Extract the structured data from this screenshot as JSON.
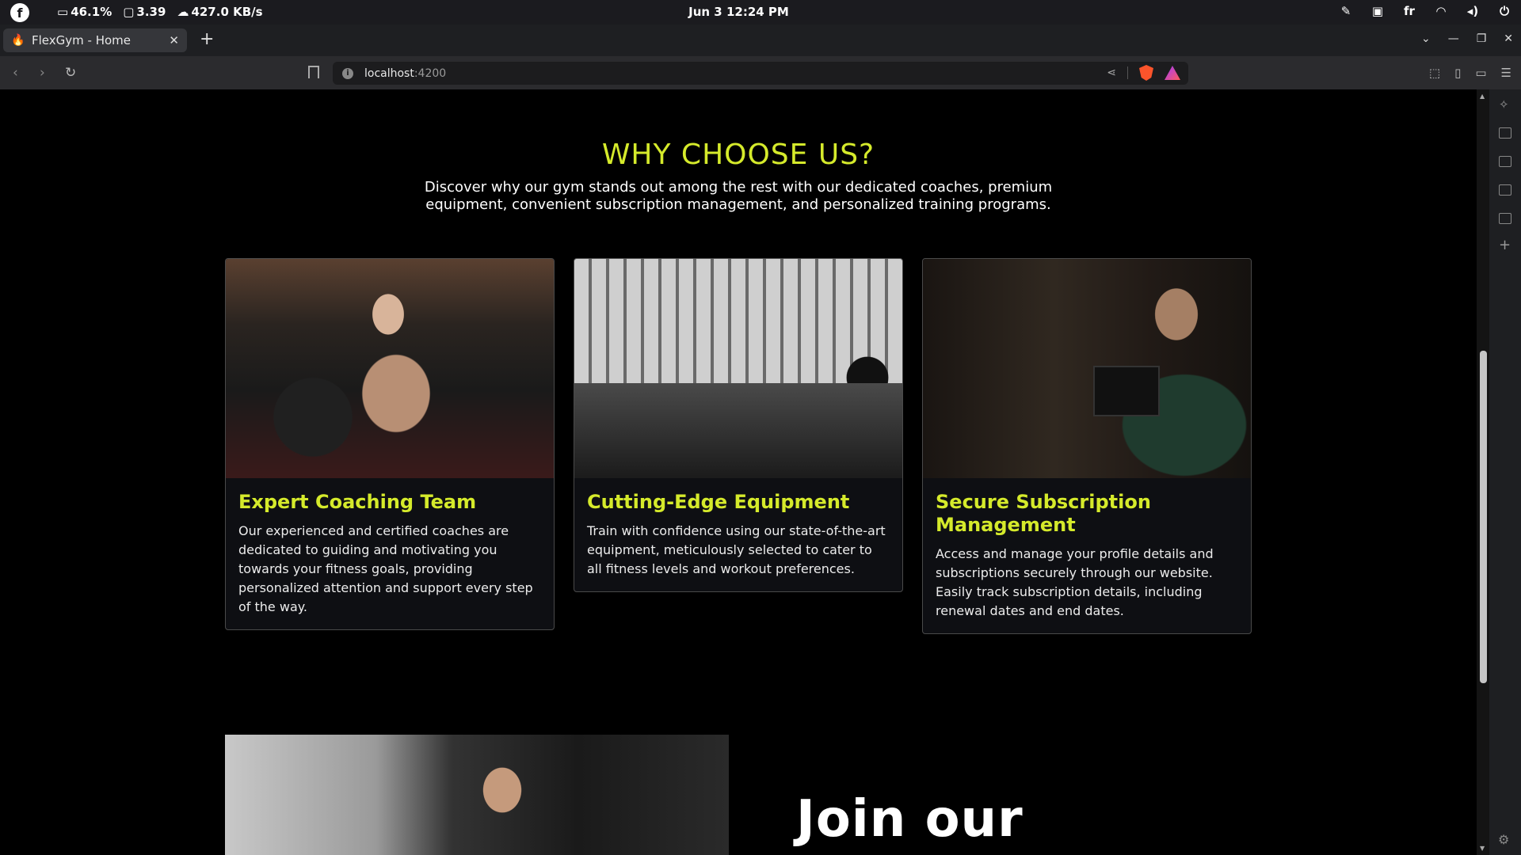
{
  "os": {
    "battery": "46.1%",
    "load": "3.39",
    "net": "427.0 KB/s",
    "clock": "Jun 3  12:24 PM",
    "lang": "fr"
  },
  "browser": {
    "tab_title": "FlexGym - Home",
    "url_host": "localhost",
    "url_port": ":4200"
  },
  "page": {
    "title": "WHY CHOOSE US?",
    "subtitle": "Discover why our gym stands out among the rest with our dedicated coaches, premium equipment, convenient subscription management, and personalized training programs.",
    "cards": [
      {
        "title": "Expert Coaching Team",
        "text": "Our experienced and certified coaches are dedicated to guiding and motivating you towards your fitness goals, providing personalized attention and support every step of the way."
      },
      {
        "title": "Cutting-Edge Equipment",
        "text": "Train with confidence using our state-of-the-art equipment, meticulously selected to cater to all fitness levels and workout preferences."
      },
      {
        "title": "Secure Subscription Management",
        "text": "Access and manage your profile details and subscriptions securely through our website. Easily track subscription details, including renewal dates and end dates."
      }
    ],
    "join_title": "Join our"
  },
  "colors": {
    "accent": "#d5ea2b",
    "background": "#000000"
  }
}
